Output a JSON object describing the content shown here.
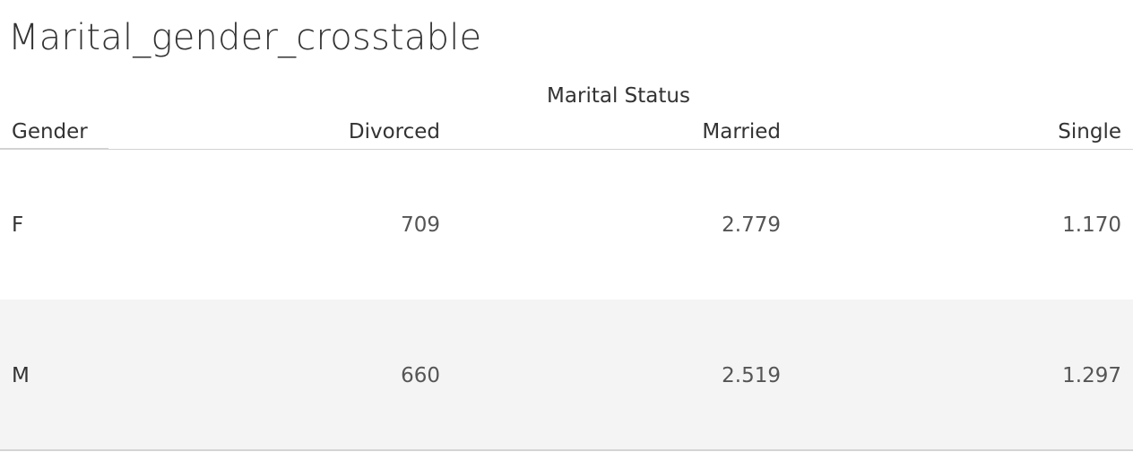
{
  "title": "Marital_gender_crosstable",
  "chart_data": {
    "type": "table",
    "title": "Marital_gender_crosstable",
    "column_group_label": "Marital Status",
    "row_header_label": "Gender",
    "columns": [
      "Divorced",
      "Married",
      "Single"
    ],
    "rows": [
      {
        "label": "F",
        "values": [
          "709",
          "2.779",
          "1.170"
        ]
      },
      {
        "label": "M",
        "values": [
          "660",
          "2.519",
          "1.297"
        ]
      }
    ]
  }
}
